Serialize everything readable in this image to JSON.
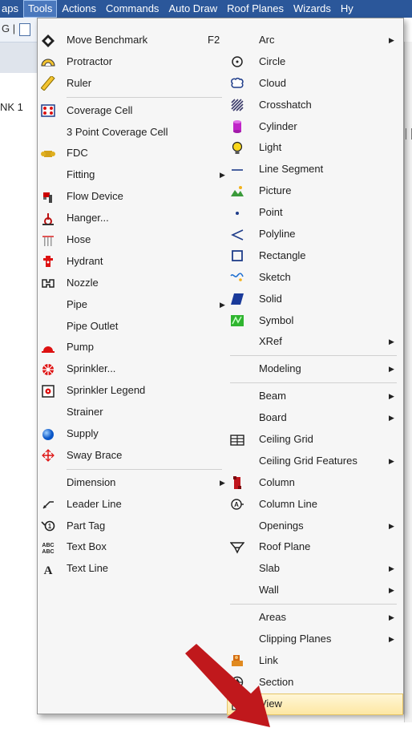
{
  "menubar": {
    "items": [
      "aps",
      "Tools",
      "Actions",
      "Commands",
      "Auto Draw",
      "Roof Planes",
      "Wizards",
      "Hy"
    ]
  },
  "background": {
    "toolbar_text": "G |",
    "canvas_label": "NK 1"
  },
  "menu_left": {
    "items": [
      {
        "label": "Move Benchmark",
        "icon": "move-benchmark-icon",
        "shortcut": "F2"
      },
      {
        "label": "Protractor",
        "icon": "protractor-icon"
      },
      {
        "label": "Ruler",
        "icon": "ruler-icon"
      },
      {
        "label": "Coverage Cell",
        "icon": "coverage-cell-icon"
      },
      {
        "label": "3 Point Coverage Cell",
        "icon": ""
      },
      {
        "label": "FDC",
        "icon": "fdc-icon"
      },
      {
        "label": "Fitting",
        "icon": "",
        "submenu": true
      },
      {
        "label": "Flow Device",
        "icon": "flow-device-icon"
      },
      {
        "label": "Hanger...",
        "icon": "hanger-icon"
      },
      {
        "label": "Hose",
        "icon": "hose-icon"
      },
      {
        "label": "Hydrant",
        "icon": "hydrant-icon"
      },
      {
        "label": "Nozzle",
        "icon": "nozzle-icon"
      },
      {
        "label": "Pipe",
        "icon": "",
        "submenu": true
      },
      {
        "label": "Pipe Outlet",
        "icon": ""
      },
      {
        "label": "Pump",
        "icon": "pump-icon"
      },
      {
        "label": "Sprinkler...",
        "icon": "sprinkler-icon"
      },
      {
        "label": "Sprinkler Legend",
        "icon": "sprinkler-legend-icon"
      },
      {
        "label": "Strainer",
        "icon": ""
      },
      {
        "label": "Supply",
        "icon": "supply-icon"
      },
      {
        "label": "Sway Brace",
        "icon": "sway-brace-icon"
      },
      {
        "label": "Dimension",
        "icon": "",
        "submenu": true
      },
      {
        "label": "Leader Line",
        "icon": "leader-line-icon"
      },
      {
        "label": "Part Tag",
        "icon": "part-tag-icon"
      },
      {
        "label": "Text Box",
        "icon": "text-box-icon"
      },
      {
        "label": "Text Line",
        "icon": "text-line-icon"
      }
    ]
  },
  "menu_right": {
    "items": [
      {
        "label": "Arc",
        "icon": "",
        "submenu": true
      },
      {
        "label": "Circle",
        "icon": "circle-icon"
      },
      {
        "label": "Cloud",
        "icon": "cloud-icon"
      },
      {
        "label": "Crosshatch",
        "icon": "crosshatch-icon"
      },
      {
        "label": "Cylinder",
        "icon": "cylinder-icon"
      },
      {
        "label": "Light",
        "icon": "light-icon"
      },
      {
        "label": "Line Segment",
        "icon": "line-segment-icon"
      },
      {
        "label": "Picture",
        "icon": "picture-icon"
      },
      {
        "label": "Point",
        "icon": "point-icon"
      },
      {
        "label": "Polyline",
        "icon": "polyline-icon"
      },
      {
        "label": "Rectangle",
        "icon": "rectangle-icon"
      },
      {
        "label": "Sketch",
        "icon": "sketch-icon"
      },
      {
        "label": "Solid",
        "icon": "solid-icon"
      },
      {
        "label": "Symbol",
        "icon": "symbol-icon"
      },
      {
        "label": "XRef",
        "icon": "",
        "submenu": true
      },
      {
        "label": "Modeling",
        "icon": "",
        "submenu": true
      },
      {
        "label": "Beam",
        "icon": "",
        "submenu": true
      },
      {
        "label": "Board",
        "icon": "",
        "submenu": true
      },
      {
        "label": "Ceiling Grid",
        "icon": "ceiling-grid-icon"
      },
      {
        "label": "Ceiling Grid Features",
        "icon": "",
        "submenu": true
      },
      {
        "label": "Column",
        "icon": "column-icon"
      },
      {
        "label": "Column Line",
        "icon": "column-line-icon"
      },
      {
        "label": "Openings",
        "icon": "",
        "submenu": true
      },
      {
        "label": "Roof Plane",
        "icon": "roof-plane-icon"
      },
      {
        "label": "Slab",
        "icon": "",
        "submenu": true
      },
      {
        "label": "Wall",
        "icon": "",
        "submenu": true
      },
      {
        "label": "Areas",
        "icon": "",
        "submenu": true
      },
      {
        "label": "Clipping Planes",
        "icon": "",
        "submenu": true
      },
      {
        "label": "Link",
        "icon": "link-icon"
      },
      {
        "label": "Section",
        "icon": "section-icon"
      },
      {
        "label": "View",
        "icon": "view-icon",
        "highlighted": true
      }
    ]
  },
  "colors": {
    "menubar": "#2b579a",
    "menu_bg": "#f6f6f6",
    "highlight": "#fde7a3",
    "pointer": "#c0181c"
  }
}
